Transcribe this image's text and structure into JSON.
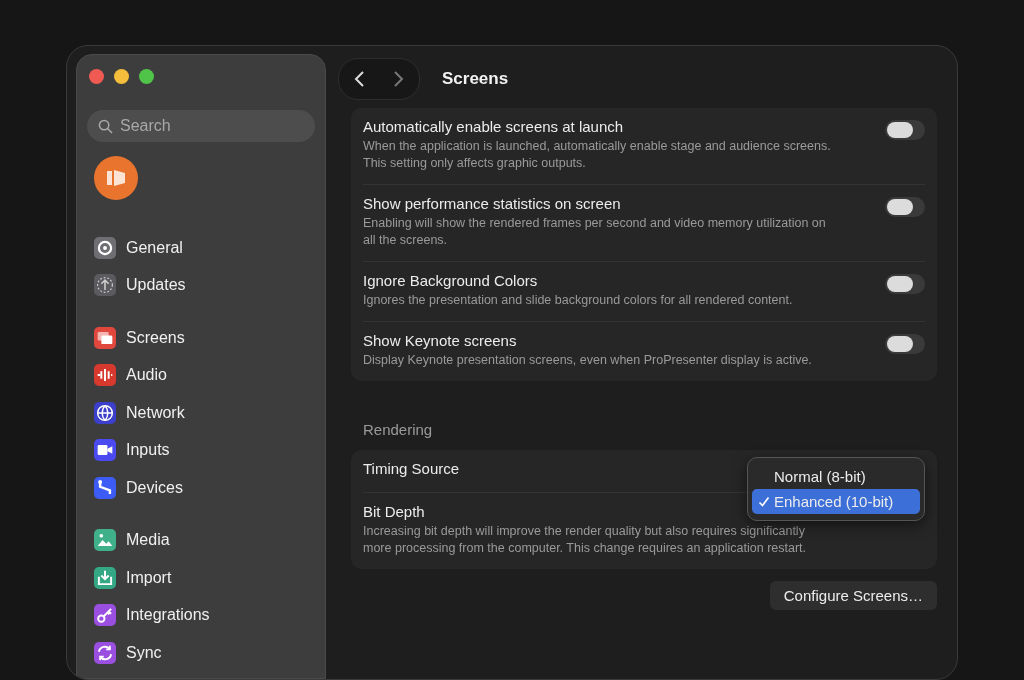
{
  "sidebar": {
    "search": {
      "placeholder": "Search"
    },
    "groups": [
      [
        {
          "label": "General",
          "color": "#6e6e73"
        },
        {
          "label": "Updates",
          "color": "#5a5a5f"
        }
      ],
      [
        {
          "label": "Screens",
          "color": "#e0483e"
        },
        {
          "label": "Audio",
          "color": "#d8392f"
        },
        {
          "label": "Network",
          "color": "#3b3fc9"
        },
        {
          "label": "Inputs",
          "color": "#4a4af0"
        },
        {
          "label": "Devices",
          "color": "#3d5cf5"
        }
      ],
      [
        {
          "label": "Media",
          "color": "#3fb08a"
        },
        {
          "label": "Import",
          "color": "#34a784"
        },
        {
          "label": "Integrations",
          "color": "#9b4fe0"
        },
        {
          "label": "Sync",
          "color": "#9b4fe0"
        }
      ]
    ]
  },
  "page": {
    "title": "Screens",
    "cards": [
      {
        "rows": [
          {
            "kind": "toggle",
            "title": "Automatically enable screens at launch",
            "description": "When the application is launched, automatically enable stage and audience screens. This setting only affects graphic outputs.",
            "on": false
          },
          {
            "kind": "toggle",
            "title": "Show performance statistics on screen",
            "description": "Enabling will show the rendered frames per second and video memory utilization on all the screens.",
            "on": false
          },
          {
            "kind": "toggle",
            "title": "Ignore Background Colors",
            "description": "Ignores the presentation and slide background colors for all rendered content.",
            "on": false
          },
          {
            "kind": "toggle",
            "title": "Show Keynote screens",
            "description": "Display Keynote presentation screens, even when ProPresenter display is active.",
            "on": false
          }
        ]
      },
      {
        "heading": "Rendering",
        "rows": [
          {
            "kind": "plain",
            "title": "Timing Source"
          },
          {
            "kind": "menu",
            "title": "Bit Depth",
            "description": "Increasing bit depth will improve the render quality but also requires significantly more processing from the computer. This change requires an application restart.",
            "menu": [
              {
                "label": "Normal (8-bit)",
                "selected": false
              },
              {
                "label": "Enhanced (10-bit)",
                "selected": true
              }
            ]
          }
        ]
      }
    ],
    "button": "Configure Screens…"
  }
}
